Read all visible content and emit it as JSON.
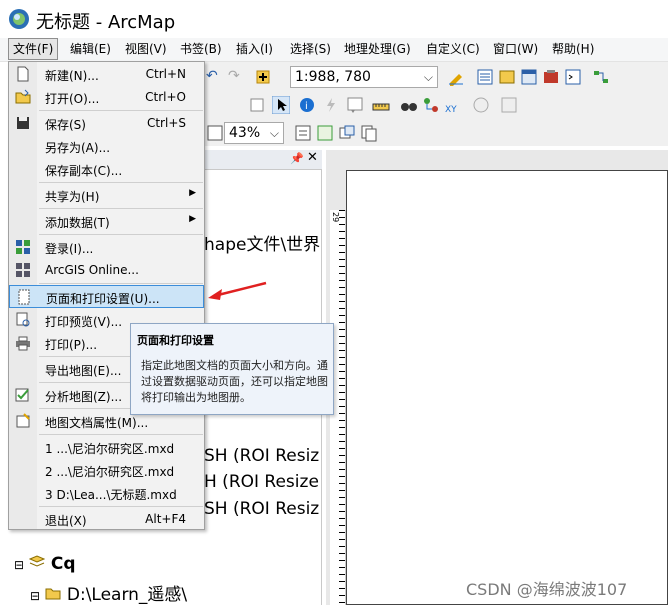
{
  "window": {
    "title": "无标题 - ArcMap"
  },
  "menubar": [
    {
      "label": "文件(F)",
      "active": true
    },
    {
      "label": "编辑(E)"
    },
    {
      "label": "视图(V)"
    },
    {
      "label": "书签(B)"
    },
    {
      "label": "插入(I)"
    },
    {
      "label": "选择(S)"
    },
    {
      "label": "地理处理(G)"
    },
    {
      "label": "自定义(C)"
    },
    {
      "label": "窗口(W)"
    },
    {
      "label": "帮助(H)"
    }
  ],
  "toolbar": {
    "scale_value": "1:988, 780",
    "zoom_value": "43%"
  },
  "file_menu": {
    "items": [
      {
        "label": "新建(N)...",
        "shortcut": "Ctrl+N",
        "icon": "new-document-icon"
      },
      {
        "label": "打开(O)...",
        "shortcut": "Ctrl+O",
        "icon": "open-folder-icon"
      },
      {
        "label": "保存(S)",
        "shortcut": "Ctrl+S",
        "icon": "save-disk-icon"
      },
      {
        "label": "另存为(A)...",
        "shortcut": ""
      },
      {
        "label": "保存副本(C)...",
        "shortcut": ""
      },
      {
        "label": "共享为(H)",
        "submenu": true
      },
      {
        "label": "添加数据(T)",
        "submenu": true
      },
      {
        "label": "登录(I)...",
        "icon": "sign-in-grid-icon"
      },
      {
        "label": "ArcGIS Online...",
        "icon": "arcgis-online-grid-icon"
      },
      {
        "label": "页面和打印设置(U)...",
        "icon": "page-setup-icon",
        "highlighted": true
      },
      {
        "label": "打印预览(V)...",
        "icon": "print-preview-icon"
      },
      {
        "label": "打印(P)...",
        "icon": "printer-icon"
      },
      {
        "label": "导出地图(E)..."
      },
      {
        "label": "分析地图(Z)...",
        "icon": "analyze-map-icon"
      },
      {
        "label": "地图文档属性(M)...",
        "icon": "document-properties-icon"
      },
      {
        "label": "1 ...\\尼泊尔研究区.mxd"
      },
      {
        "label": "2 ...\\尼泊尔研究区.mxd"
      },
      {
        "label": "3 D:\\Lea...\\无标题.mxd"
      },
      {
        "label": "退出(X)",
        "shortcut": "Alt+F4"
      }
    ]
  },
  "tooltip": {
    "title": "页面和打印设置",
    "body": "指定此地图文档的页面大小和方向。通过设置数据驱动页面，还可以指定地图将打印输出为地图册。"
  },
  "toc": {
    "partial_text_1": "hape文件\\世界",
    "partial_text_2": "SH (ROI Resiz",
    "partial_text_3": "H (ROI Resize",
    "partial_text_4": "SH (ROI Resiz",
    "layer_group": "Cq",
    "folder": "D:\\Learn_遥感\\"
  },
  "ruler": {
    "label": "29"
  },
  "watermark": "CSDN @海绵波波107"
}
